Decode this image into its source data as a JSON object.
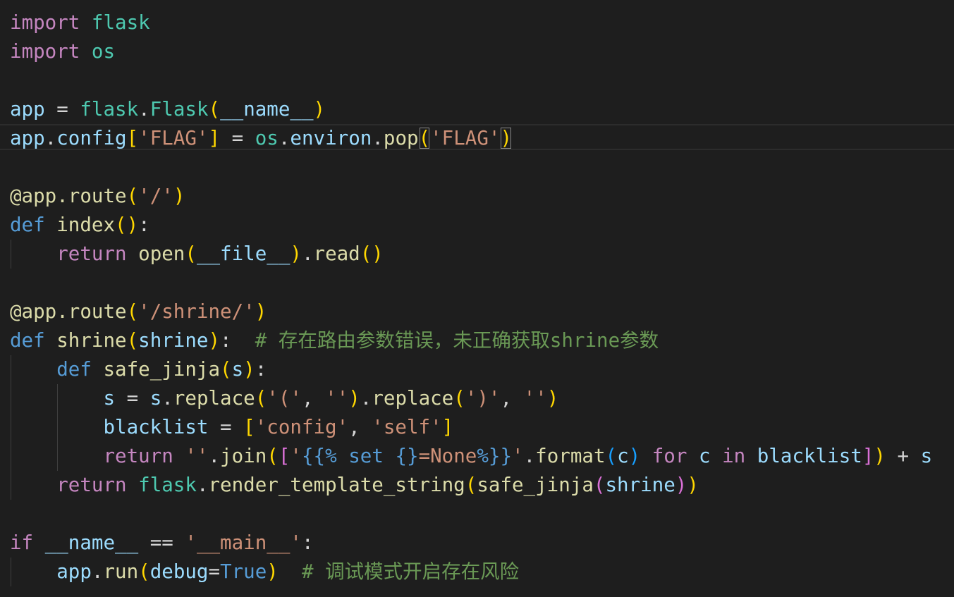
{
  "editor": {
    "language": "python",
    "comment_route_bug": "# 存在路由参数错误，未正确获取shrine参数",
    "comment_debug": "# 调试模式开启存在风险"
  }
}
